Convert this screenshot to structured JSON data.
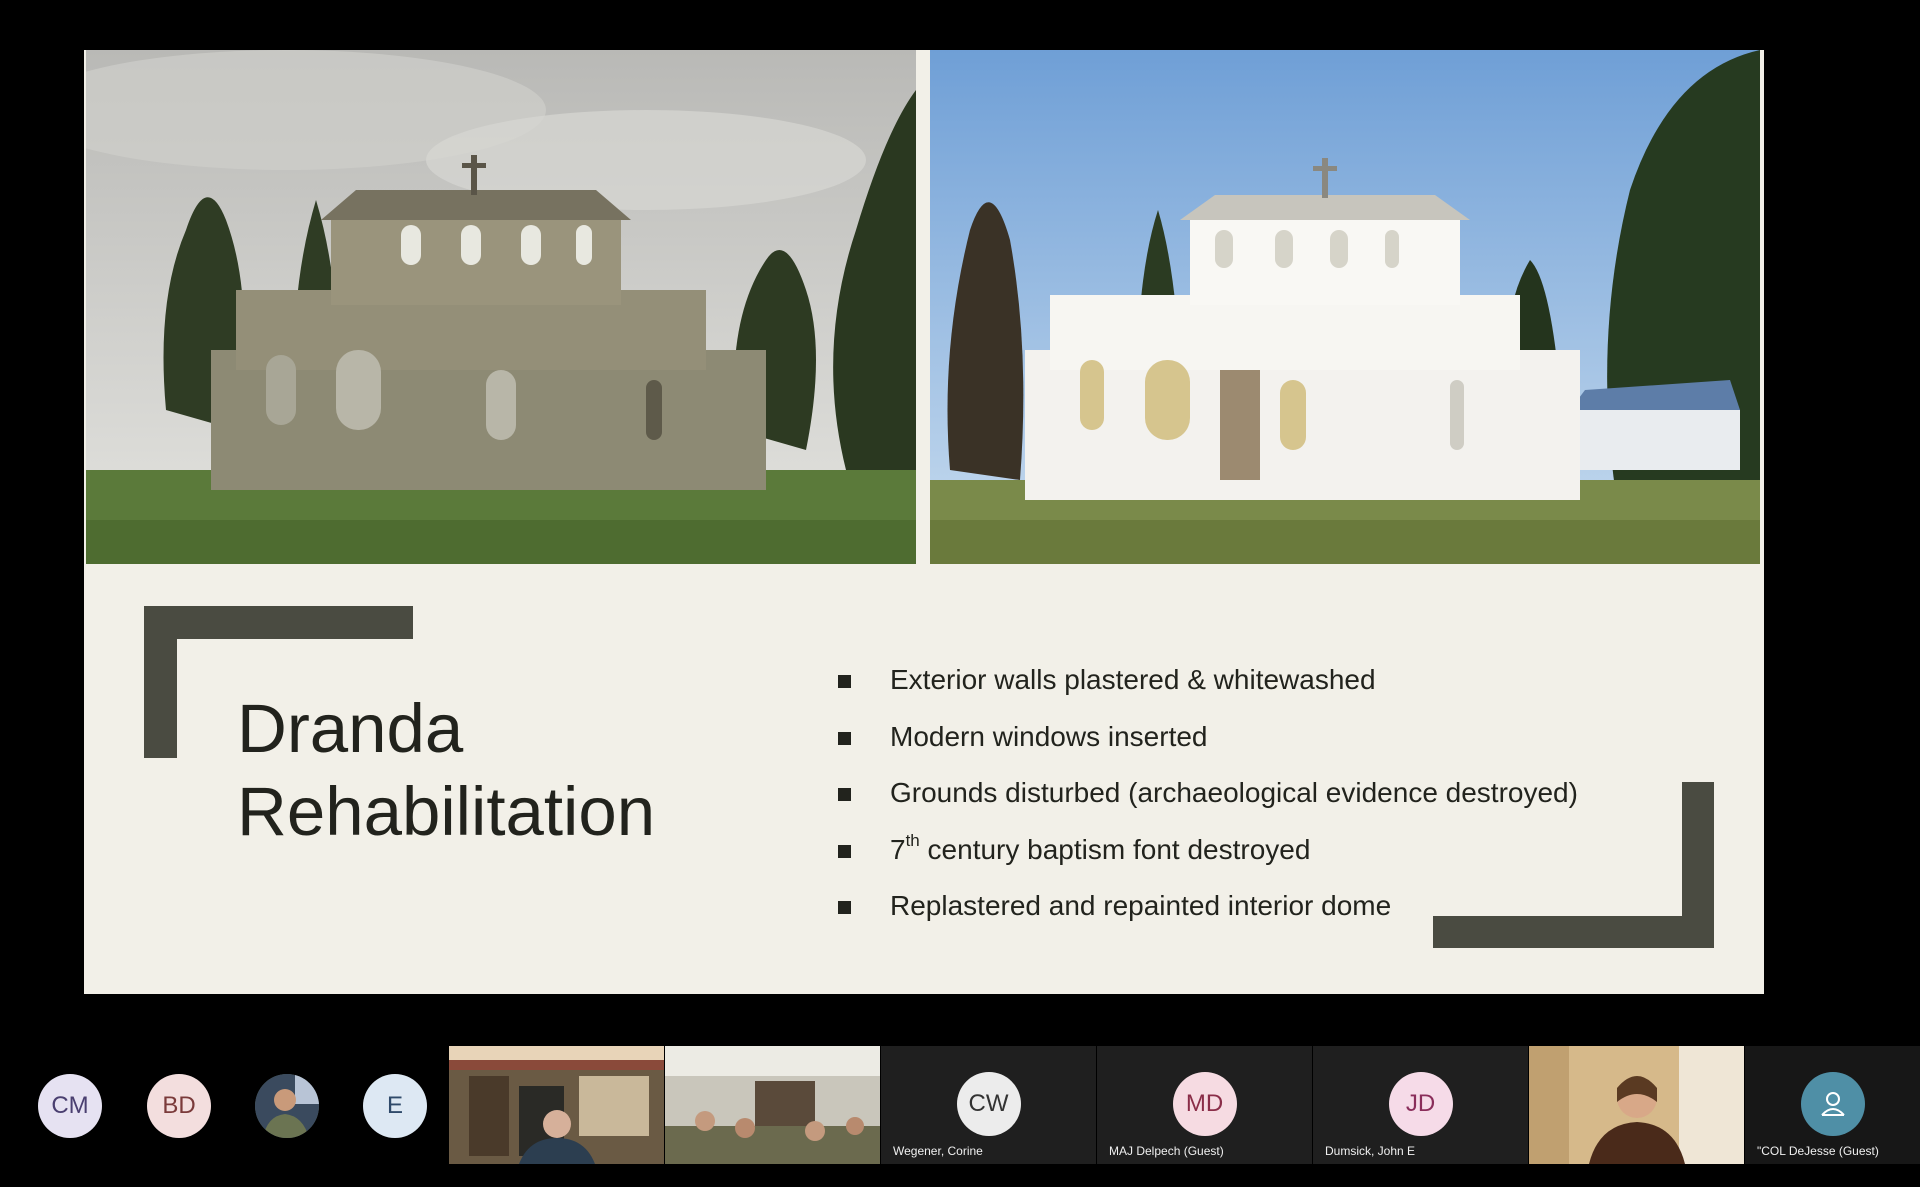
{
  "slide": {
    "title_lines": [
      "Dranda",
      "Rehabilitation"
    ],
    "bullets": [
      {
        "pre": "Exterior walls plastered & whitewashed",
        "sup": "",
        "post": ""
      },
      {
        "pre": "Modern windows inserted",
        "sup": "",
        "post": ""
      },
      {
        "pre": "Grounds disturbed (archaeological evidence destroyed)",
        "sup": "",
        "post": ""
      },
      {
        "pre": "7",
        "sup": "th",
        "post": " century baptism font destroyed"
      },
      {
        "pre": "Replastered and repainted interior dome",
        "sup": "",
        "post": ""
      }
    ],
    "accent_color": "#4a4b41",
    "background_color": "#f2f0e8"
  },
  "participants": [
    {
      "initials": "CM",
      "avatar_bg": "#e6e2f2",
      "avatar_fg": "#4a3f70"
    },
    {
      "initials": "BD",
      "avatar_bg": "#f3dede",
      "avatar_fg": "#7a3a3a"
    },
    {
      "initials": "",
      "avatar_bg": "#5a6a4a",
      "avatar_fg": "#ffffff"
    },
    {
      "initials": "E",
      "avatar_bg": "#dde8f3",
      "avatar_fg": "#2f4a6a"
    },
    {
      "initials": "CW",
      "name": "Wegener, Corine",
      "avatar_bg": "#ececec",
      "avatar_fg": "#333333"
    },
    {
      "initials": "MD",
      "name": "MAJ Delpech (Guest)",
      "avatar_bg": "#f6dbe2",
      "avatar_fg": "#8a2d48"
    },
    {
      "initials": "JD",
      "name": "Dumsick, John E",
      "avatar_bg": "#f6dbe8",
      "avatar_fg": "#8a2d5a"
    },
    {
      "initials": "",
      "name": "\"COL DeJesse (Guest)",
      "avatar_bg": "#4f8fa6",
      "avatar_fg": "#ffffff"
    }
  ]
}
